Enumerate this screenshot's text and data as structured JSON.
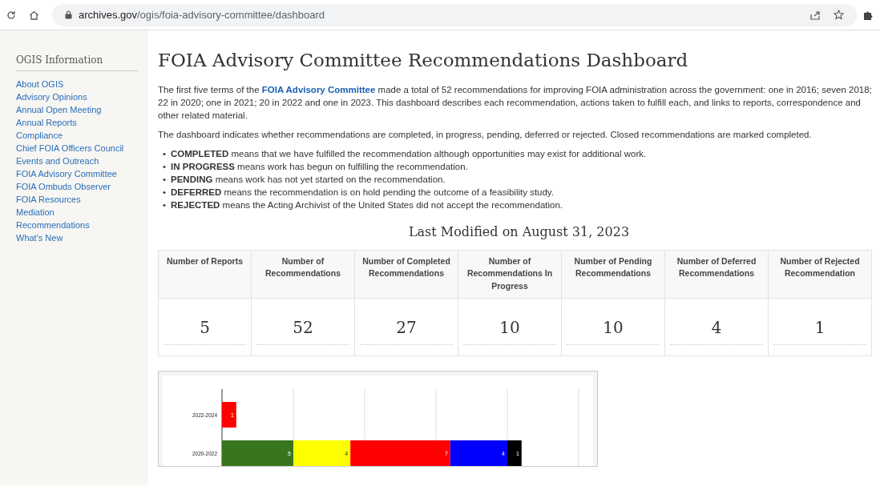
{
  "browser": {
    "url_host": "archives.gov",
    "url_path": "/ogis/foia-advisory-committee/dashboard"
  },
  "sidebar": {
    "title": "OGIS Information",
    "items": [
      {
        "label": "About OGIS"
      },
      {
        "label": "Advisory Opinions"
      },
      {
        "label": "Annual Open Meeting"
      },
      {
        "label": "Annual Reports"
      },
      {
        "label": "Compliance"
      },
      {
        "label": "Chief FOIA Officers Council"
      },
      {
        "label": "Events and Outreach"
      },
      {
        "label": "FOIA Advisory Committee"
      },
      {
        "label": "FOIA Ombuds Observer"
      },
      {
        "label": "FOIA Resources"
      },
      {
        "label": "Mediation"
      },
      {
        "label": "Recommendations"
      },
      {
        "label": "What's New"
      }
    ]
  },
  "main": {
    "title": "FOIA Advisory Committee Recommendations Dashboard",
    "intro": {
      "before": "The first five terms of the",
      "link": "FOIA Advisory Committee",
      "after": "made a total of 52 recommendations for improving FOIA administration across the government: one in 2016; seven 2018; 22 in 2020; one in 2021; 20 in 2022 and one in 2023. This dashboard describes each recommendation, actions taken to fulfill each, and links to reports, correspondence and other related material."
    },
    "summary": "The dashboard indicates whether recommendations are completed, in progress, pending, deferred or rejected. Closed recommendations are marked completed.",
    "definitions": [
      {
        "marker": "•",
        "text": "**COMPLETED** means that we have fulfilled the recommendation although opportunities may exist for additional work."
      },
      {
        "marker": "•",
        "text": "**IN PROGRESS** means work has begun on fulfilling the recommendation."
      },
      {
        "marker": "•",
        "text": "**PENDING** means work has not yet started on the recommendation."
      },
      {
        "marker": "•",
        "text": "**DEFERRED** means the recommendation is on hold pending the outcome of a feasibility study."
      },
      {
        "marker": "•",
        "text": "**REJECTED** means the Acting Archivist of the United States did not accept the recommendation."
      }
    ],
    "last_modified": "Last Modified on August 31, 2023",
    "stats": [
      {
        "heading": "Number of Reports",
        "value": "5"
      },
      {
        "heading": "Number of Recommendations",
        "value": "52"
      },
      {
        "heading": "Number of Completed Recommendations",
        "value": "27"
      },
      {
        "heading": "Number of Recommendations In Progress",
        "value": "10"
      },
      {
        "heading": "Number of Pending Recommendations",
        "value": "10"
      },
      {
        "heading": "Number of Deferred Recommendations",
        "value": "4"
      },
      {
        "heading": "Number of Rejected Recommendation",
        "value": "1"
      }
    ],
    "chart": {
      "chart_data": {
        "type": "bar",
        "orientation": "horizontal",
        "stacked": true,
        "data_labels": true,
        "categories": [
          "2022-2024",
          "2020-2022"
        ],
        "series": [
          {
            "color": "#38761d",
            "values": [
              null,
              5
            ]
          },
          {
            "color": "#ffff00",
            "values": [
              null,
              4
            ]
          },
          {
            "color": "#ff0000",
            "values": [
              1,
              7
            ]
          },
          {
            "color": "#0000ff",
            "values": [
              null,
              4
            ]
          },
          {
            "color": "#000000",
            "values": [
              null,
              1
            ]
          }
        ]
      }
    }
  }
}
